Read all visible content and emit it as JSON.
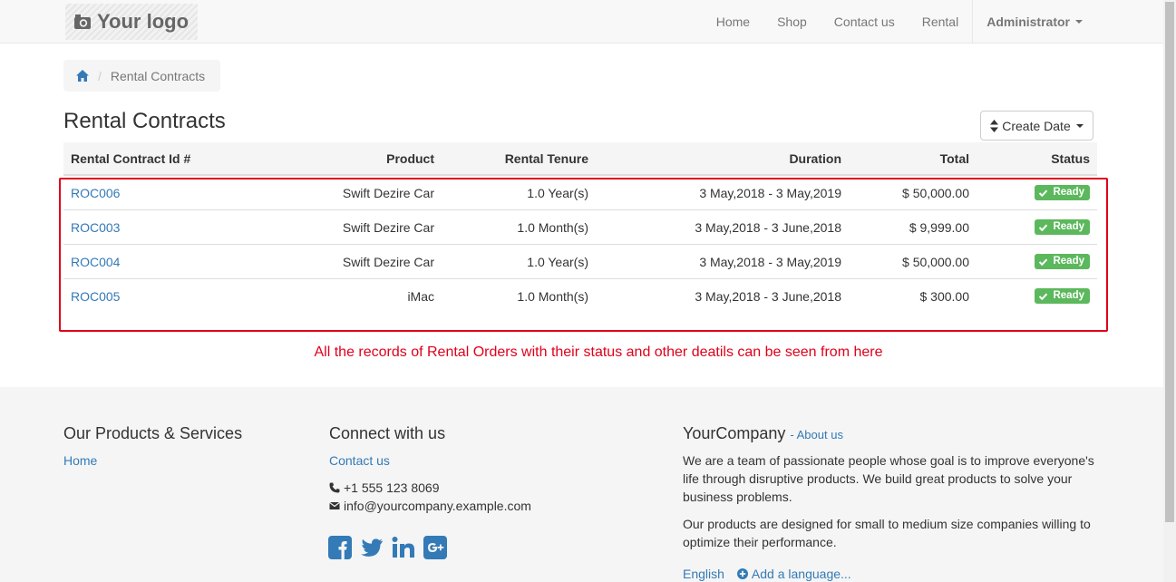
{
  "navbar": {
    "logo_text": "Your logo",
    "links": [
      "Home",
      "Shop",
      "Contact us",
      "Rental"
    ],
    "user": "Administrator"
  },
  "breadcrumb": {
    "current": "Rental Contracts"
  },
  "page": {
    "title": "Rental Contracts",
    "sort_label": "Create Date"
  },
  "table": {
    "columns": [
      "Rental Contract Id #",
      "Product",
      "Rental Tenure",
      "Duration",
      "Total",
      "Status"
    ],
    "rows": [
      {
        "id": "ROC006",
        "product": "Swift Dezire Car",
        "tenure": "1.0 Year(s)",
        "duration": "3 May,2018 - 3 May,2019",
        "total": "$ 50,000.00",
        "status": "Ready"
      },
      {
        "id": "ROC003",
        "product": "Swift Dezire Car",
        "tenure": "1.0 Month(s)",
        "duration": "3 May,2018 - 3 June,2018",
        "total": "$ 9,999.00",
        "status": "Ready"
      },
      {
        "id": "ROC004",
        "product": "Swift Dezire Car",
        "tenure": "1.0 Year(s)",
        "duration": "3 May,2018 - 3 May,2019",
        "total": "$ 50,000.00",
        "status": "Ready"
      },
      {
        "id": "ROC005",
        "product": "iMac",
        "tenure": "1.0 Month(s)",
        "duration": "3 May,2018 - 3 June,2018",
        "total": "$ 300.00",
        "status": "Ready"
      }
    ]
  },
  "annotation": "All the records of Rental Orders with their status and other deatils can be seen from here",
  "footer": {
    "products_title": "Our Products & Services",
    "products_link": "Home",
    "connect_title": "Connect with us",
    "contact_link": "Contact us",
    "phone": "+1 555 123 8069",
    "email": "info@yourcompany.example.com",
    "social_icons": [
      "facebook-icon",
      "twitter-icon",
      "linkedin-icon",
      "google-plus-icon"
    ],
    "company_name": "YourCompany",
    "about_link": "- About us",
    "about_p1": "We are a team of passionate people whose goal is to improve everyone's life through disruptive products. We build great products to solve your business problems.",
    "about_p2": "Our products are designed for small to medium size companies willing to optimize their performance.",
    "language": "English",
    "add_language": "Add a language..."
  },
  "colors": {
    "link": "#337ab7",
    "badge": "#5cb85c",
    "annotation": "#e0001b",
    "social": "#337ab7"
  }
}
